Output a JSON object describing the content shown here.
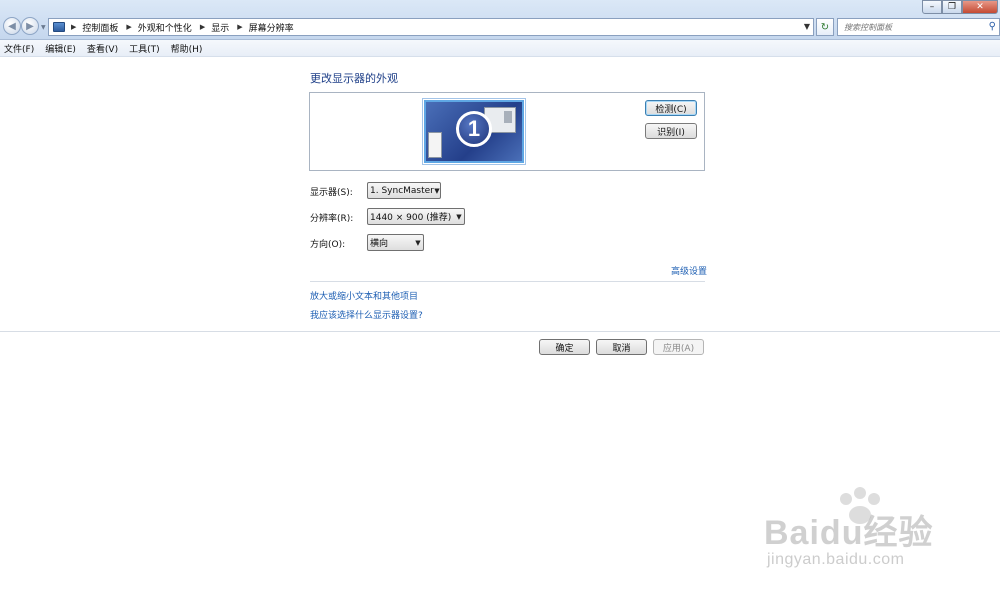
{
  "address_bar": {
    "breadcrumbs": [
      "控制面板",
      "外观和个性化",
      "显示",
      "屏幕分辨率"
    ]
  },
  "search": {
    "placeholder": "搜索控制面板"
  },
  "menu": [
    "文件(F)",
    "编辑(E)",
    "查看(V)",
    "工具(T)",
    "帮助(H)"
  ],
  "main": {
    "title": "更改显示器的外观",
    "monitor_number": "1",
    "detect_label": "检测(C)",
    "identify_label": "识别(I)",
    "display_label": "显示器(S):",
    "display_value": "1. SyncMaster",
    "resolution_label": "分辨率(R):",
    "resolution_value": "1440 × 900 (推荐)",
    "orientation_label": "方向(O):",
    "orientation_value": "横向",
    "advanced_link": "高级设置",
    "link1": "放大或缩小文本和其他项目",
    "link2": "我应该选择什么显示器设置?"
  },
  "footer": {
    "ok": "确定",
    "cancel": "取消",
    "apply": "应用(A)"
  },
  "watermark": {
    "brand": "Bai",
    "brand2": "du",
    "brand_cn": "经验",
    "site": "jingyan.baidu.com"
  },
  "colors": {
    "link": "#1e5fb3",
    "title": "#1e3f88",
    "monitor_border": "#5fa7e4"
  }
}
